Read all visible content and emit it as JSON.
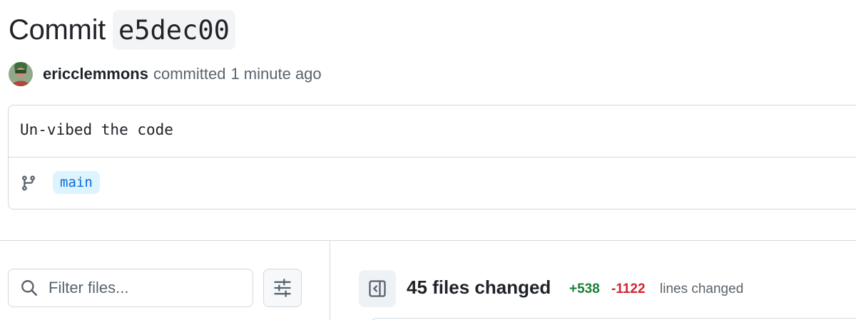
{
  "header": {
    "title_word": "Commit",
    "sha": "e5dec00"
  },
  "author": {
    "avatar_icon": "user-avatar",
    "name": "ericclemmons",
    "action": "committed",
    "time": "1 minute ago"
  },
  "commit": {
    "message": "Un-vibed the code",
    "branch_icon": "git-branch-icon",
    "branch": "main"
  },
  "files": {
    "filter_placeholder": "Filter files...",
    "search_icon": "search-icon",
    "settings_icon": "sliders-icon",
    "panel_icon": "sidebar-collapse-icon",
    "title": "45 files changed",
    "additions": "+538",
    "deletions": "-1122",
    "lines_label": "lines changed"
  },
  "colors": {
    "accent": "#0969da",
    "additions": "#1a7f37",
    "deletions": "#d1242f",
    "border": "#d1d9e0"
  }
}
